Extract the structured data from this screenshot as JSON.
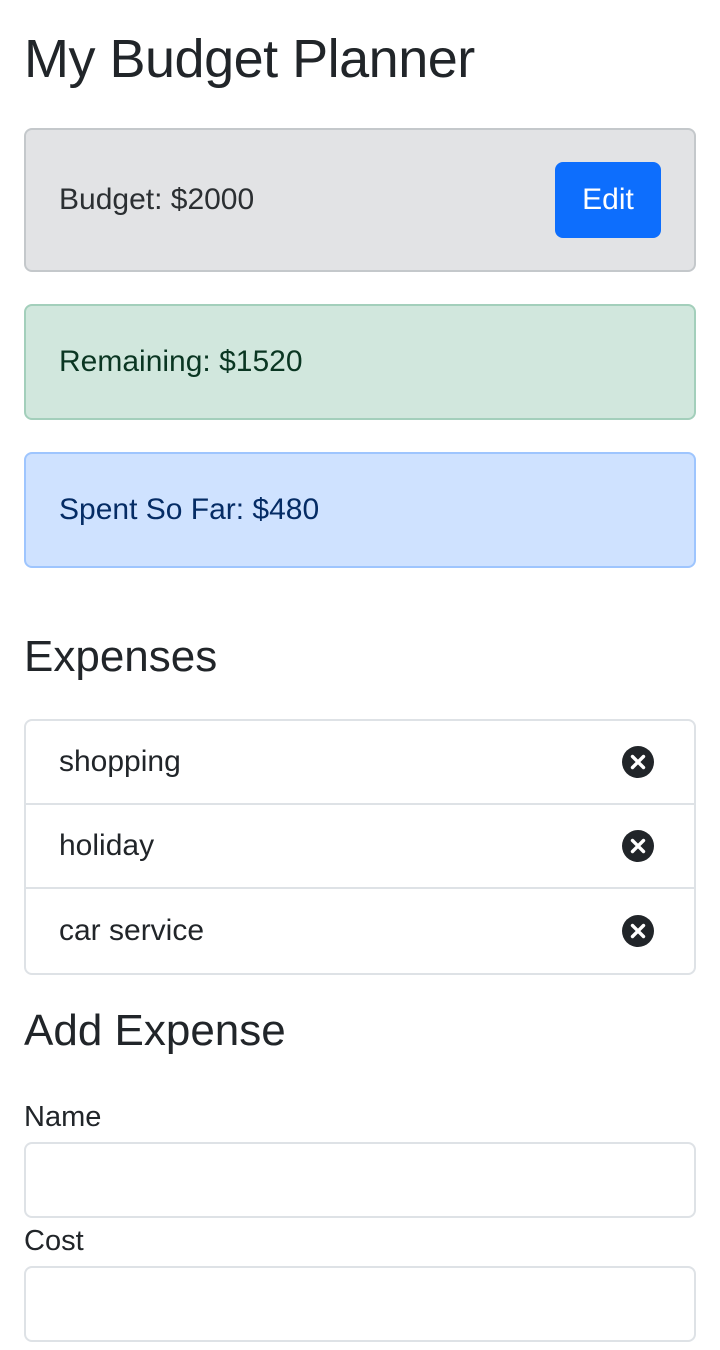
{
  "header": {
    "title": "My Budget Planner"
  },
  "budget": {
    "text": "Budget: $2000",
    "edit_label": "Edit"
  },
  "remaining": {
    "text": "Remaining: $1520"
  },
  "spent": {
    "text": "Spent So Far: $480"
  },
  "expenses": {
    "heading": "Expenses",
    "items": [
      {
        "name": "shopping",
        "icon": "close-circle-icon"
      },
      {
        "name": "holiday",
        "icon": "close-circle-icon"
      },
      {
        "name": "car service",
        "icon": "close-circle-icon"
      }
    ]
  },
  "add_expense": {
    "heading": "Add Expense",
    "name_label": "Name",
    "name_value": "",
    "cost_label": "Cost",
    "cost_value": ""
  },
  "colors": {
    "primary": "#0d6efd",
    "secondary_bg": "#e2e3e5",
    "success_bg": "#d1e7dd",
    "info_bg": "#cfe2ff"
  }
}
